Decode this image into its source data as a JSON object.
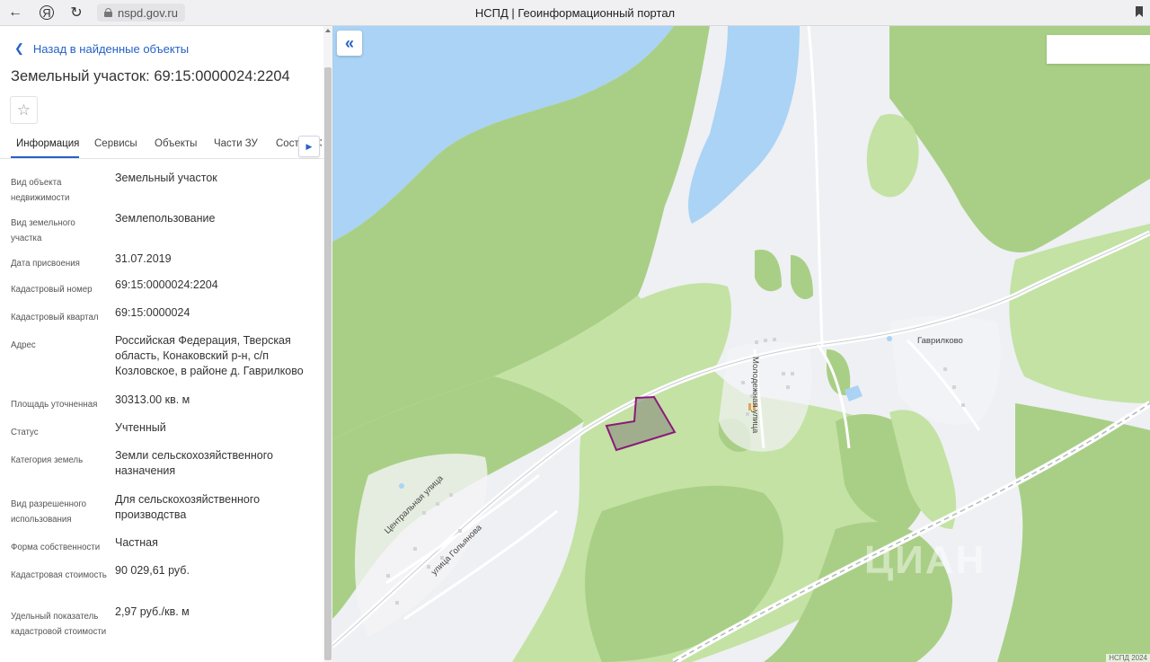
{
  "browser": {
    "back_icon": "arrow-left-icon",
    "yandex_icon": "yandex-logo-icon",
    "reload_icon": "reload-icon",
    "url": "nspd.gov.ru",
    "title": "НСПД | Геоинформационный портал"
  },
  "panel": {
    "back_label": "Назад в найденные объекты",
    "title": "Земельный участок: 69:15:0000024:2204",
    "tabs": [
      {
        "label": "Информация"
      },
      {
        "label": "Сервисы"
      },
      {
        "label": "Объекты"
      },
      {
        "label": "Части ЗУ"
      },
      {
        "label": "Состав ЕЗП"
      }
    ],
    "properties": [
      {
        "label": "Вид объекта недвижимости",
        "value": "Земельный участок"
      },
      {
        "label": "Вид земельного участка",
        "value": "Землепользование"
      },
      {
        "label": "Дата присвоения",
        "value": "31.07.2019"
      },
      {
        "label": "Кадастровый номер",
        "value": "69:15:0000024:2204"
      },
      {
        "label": "Кадастровый квартал",
        "value": "69:15:0000024"
      },
      {
        "label": "Адрес",
        "value": "Российская Федерация, Тверская область, Конаковский р-н, с/п Козловское, в районе д. Гаврилково"
      },
      {
        "label": "Площадь уточненная",
        "value": "30313.00 кв. м"
      },
      {
        "label": "Статус",
        "value": "Учтенный"
      },
      {
        "label": "Категория земель",
        "value": "Земли сельскохозяйственного назначения"
      },
      {
        "label": "Вид разрешенного использования",
        "value": "Для сельскохозяйственного производства"
      },
      {
        "label": "Форма собственности",
        "value": "Частная"
      },
      {
        "label": "Кадастровая стоимость",
        "value": "90 029,61 руб."
      },
      {
        "label": "Удельный показатель кадастровой стоимости",
        "value": "2,97 руб./кв. м"
      }
    ]
  },
  "map": {
    "labels": {
      "village": "Гаврилково",
      "street_central": "Центральная улица",
      "street_golyanova": "улица Гольянова",
      "street_molodezhnaya": "Молодежная улица"
    },
    "watermark": "ЦИАН",
    "copyright": "НСПД 2024",
    "colors": {
      "forest": "#a9cf86",
      "meadow": "#c3e2a4",
      "water": "#aad3f5",
      "background": "#eef0f3",
      "parcel_border": "#8b1a7a"
    }
  }
}
